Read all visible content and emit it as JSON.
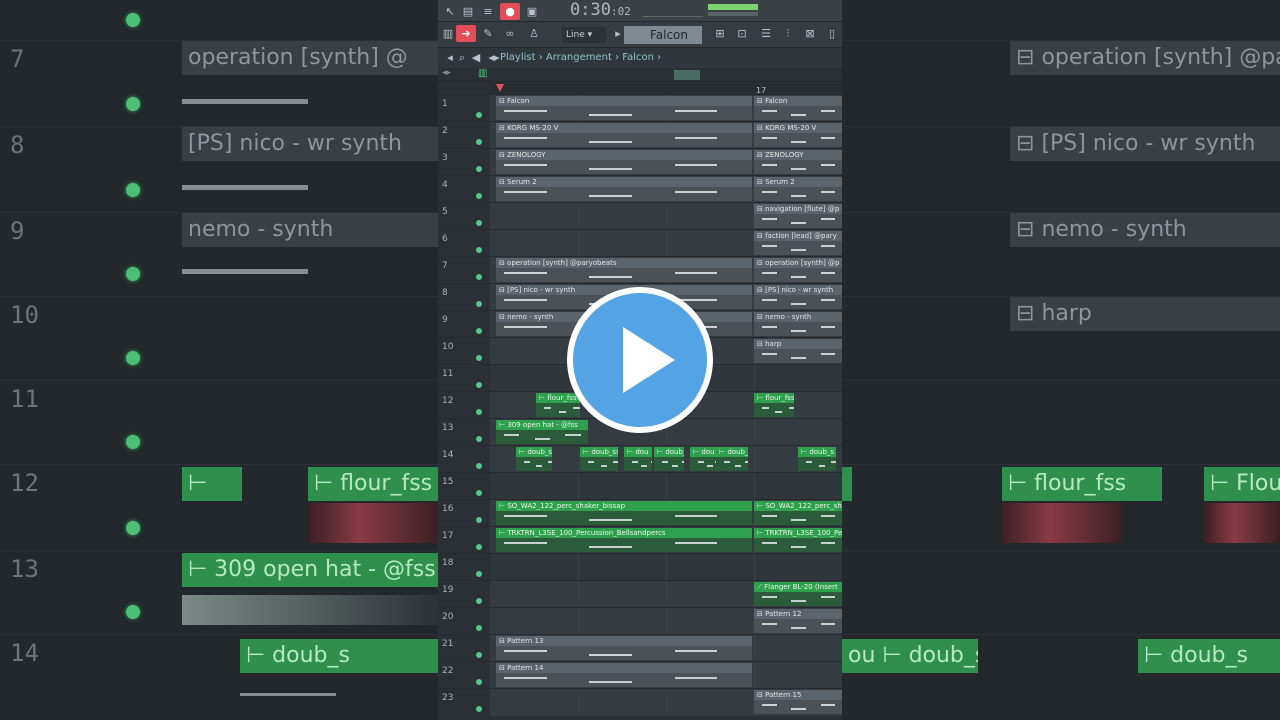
{
  "toolbar": {
    "time_main": "0:30",
    "time_sub": "02",
    "snap_label": "Line",
    "pattern_label": "Falcon"
  },
  "breadcrumb": {
    "parts": [
      "Playlist",
      "Arrangement",
      "Falcon"
    ],
    "text": "Playlist › Arrangement › Falcon ›"
  },
  "ruler": {
    "bar_17": "17"
  },
  "tracks": [
    {
      "num": "1",
      "clips": [
        {
          "label": "Falcon",
          "type": "pattern"
        },
        {
          "label": "Falcon",
          "type": "pattern"
        }
      ]
    },
    {
      "num": "2",
      "clips": [
        {
          "label": "KORG MS-20 V",
          "type": "pattern"
        },
        {
          "label": "KORG MS-20 V",
          "type": "pattern"
        }
      ]
    },
    {
      "num": "3",
      "clips": [
        {
          "label": "ZENOLOGY",
          "type": "pattern"
        },
        {
          "label": "ZENOLOGY",
          "type": "pattern"
        }
      ]
    },
    {
      "num": "4",
      "clips": [
        {
          "label": "Serum 2",
          "type": "pattern"
        },
        {
          "label": "Serum 2",
          "type": "pattern"
        }
      ]
    },
    {
      "num": "5",
      "clips": [
        {
          "label": "navigation [flute] @p",
          "type": "pattern"
        }
      ]
    },
    {
      "num": "6",
      "clips": [
        {
          "label": "faction [lead] @pary",
          "type": "pattern"
        }
      ]
    },
    {
      "num": "7",
      "clips": [
        {
          "label": "operation [synth] @paryobeats",
          "type": "pattern"
        },
        {
          "label": "operation [synth] @p",
          "type": "pattern"
        }
      ]
    },
    {
      "num": "8",
      "clips": [
        {
          "label": "[PS] nico - wr synth",
          "type": "pattern"
        },
        {
          "label": "[PS] nico - wr synth",
          "type": "pattern"
        }
      ]
    },
    {
      "num": "9",
      "clips": [
        {
          "label": "nemo - synth",
          "type": "pattern"
        },
        {
          "label": "nemo - synth",
          "type": "pattern"
        }
      ]
    },
    {
      "num": "10",
      "clips": [
        {
          "label": "harp",
          "type": "pattern"
        }
      ]
    },
    {
      "num": "11",
      "clips": []
    },
    {
      "num": "12",
      "clips": [
        {
          "label": "flour_fss",
          "type": "audio"
        },
        {
          "label": "flour_fss",
          "type": "audio"
        }
      ]
    },
    {
      "num": "13",
      "clips": [
        {
          "label": "309 open hat - @fss",
          "type": "audio"
        }
      ]
    },
    {
      "num": "14",
      "clips": [
        {
          "label": "doub_s",
          "type": "audio"
        },
        {
          "label": "doub_ss",
          "type": "audio"
        },
        {
          "label": "dou",
          "type": "audio"
        },
        {
          "label": "doub_ss",
          "type": "audio"
        },
        {
          "label": "dou",
          "type": "audio"
        },
        {
          "label": "doub_s",
          "type": "audio"
        },
        {
          "label": "doub_s",
          "type": "audio"
        }
      ]
    },
    {
      "num": "15",
      "clips": []
    },
    {
      "num": "16",
      "clips": [
        {
          "label": "SO_WA2_122_perc_shaker_bissap",
          "type": "audio"
        },
        {
          "label": "SO_WA2_122_perc_sh",
          "type": "audio"
        }
      ]
    },
    {
      "num": "17",
      "clips": [
        {
          "label": "TRKTRN_L3SE_100_Percussion_Bellsandpercs",
          "type": "audio"
        },
        {
          "label": "TRKTRN_L3SE_100_Perc",
          "type": "audio"
        }
      ]
    },
    {
      "num": "18",
      "clips": []
    },
    {
      "num": "19",
      "clips": [
        {
          "label": "Flanger BL-20 (Insert",
          "type": "automation"
        }
      ]
    },
    {
      "num": "20",
      "clips": [
        {
          "label": "Pattern 12",
          "type": "pattern"
        }
      ]
    },
    {
      "num": "21",
      "clips": [
        {
          "label": "Pattern 13",
          "type": "pattern"
        }
      ]
    },
    {
      "num": "22",
      "clips": [
        {
          "label": "Pattern 14",
          "type": "pattern"
        }
      ]
    },
    {
      "num": "23",
      "clips": [
        {
          "label": "Pattern 15",
          "type": "pattern"
        }
      ]
    }
  ],
  "background": {
    "left_rows": [
      {
        "num": "7",
        "label": "operation [synth] @"
      },
      {
        "num": "8",
        "label": "[PS] nico - wr synth"
      },
      {
        "num": "9",
        "label": "nemo - synth"
      },
      {
        "num": "10",
        "label": ""
      },
      {
        "num": "11",
        "label": ""
      },
      {
        "num": "12",
        "label": "flour_fss"
      },
      {
        "num": "13",
        "label": "309 open hat - @fss"
      },
      {
        "num": "14",
        "label": "doub_s"
      }
    ],
    "right_rows": [
      {
        "label": "operation [synth] @pary"
      },
      {
        "label": "[PS] nico - wr synth"
      },
      {
        "label": "nemo - synth"
      },
      {
        "label": "harp"
      },
      {
        "label": ""
      },
      {
        "label": "flour_fss"
      },
      {
        "label": ""
      },
      {
        "label": "doub_s"
      }
    ]
  },
  "colors": {
    "accent_red": "#e24d58",
    "clip_green": "#2fa04d",
    "play_blue": "#53a3e5"
  }
}
